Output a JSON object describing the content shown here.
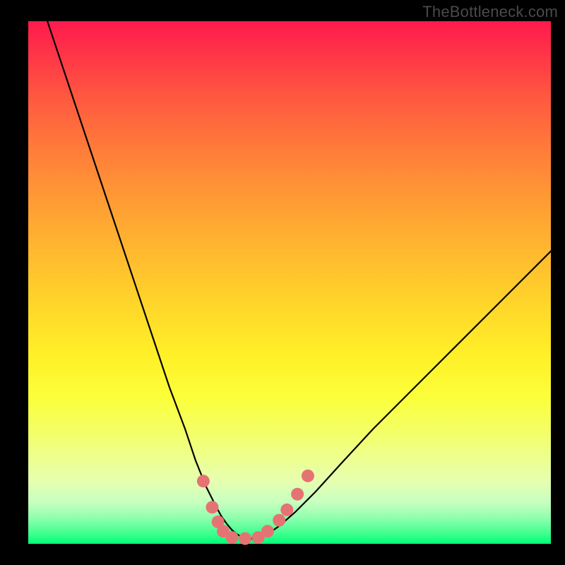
{
  "watermark": "TheBottleneck.com",
  "colors": {
    "curve_stroke": "#000000",
    "marker_fill": "#e57373",
    "marker_stroke": "#ca5a5a"
  },
  "chart_data": {
    "type": "line",
    "title": "",
    "xlabel": "",
    "ylabel": "",
    "xlim": [
      0,
      100
    ],
    "ylim": [
      0,
      100
    ],
    "x": [
      0,
      3,
      6,
      9,
      12,
      15,
      18,
      21,
      24,
      27,
      30,
      32,
      34,
      36,
      37,
      38,
      39,
      40,
      41,
      42,
      43,
      44,
      46,
      48,
      51,
      55,
      60,
      66,
      73,
      81,
      90,
      100
    ],
    "values": [
      110,
      102,
      93,
      84,
      75,
      66,
      57,
      48,
      39,
      30,
      22,
      16,
      11,
      7,
      5.2,
      3.8,
      2.6,
      1.8,
      1.2,
      1.0,
      1.0,
      1.2,
      2.0,
      3.4,
      6.0,
      10,
      15.5,
      22,
      29,
      37,
      46,
      56
    ],
    "markers": [
      {
        "x": 33.5,
        "y": 12.0
      },
      {
        "x": 35.2,
        "y": 7.0
      },
      {
        "x": 36.3,
        "y": 4.2
      },
      {
        "x": 37.3,
        "y": 2.4
      },
      {
        "x": 39.0,
        "y": 1.2
      },
      {
        "x": 41.5,
        "y": 1.0
      },
      {
        "x": 44.0,
        "y": 1.2
      },
      {
        "x": 45.8,
        "y": 2.4
      },
      {
        "x": 48.0,
        "y": 4.5
      },
      {
        "x": 49.5,
        "y": 6.5
      },
      {
        "x": 51.5,
        "y": 9.5
      },
      {
        "x": 53.5,
        "y": 13.0
      }
    ]
  }
}
